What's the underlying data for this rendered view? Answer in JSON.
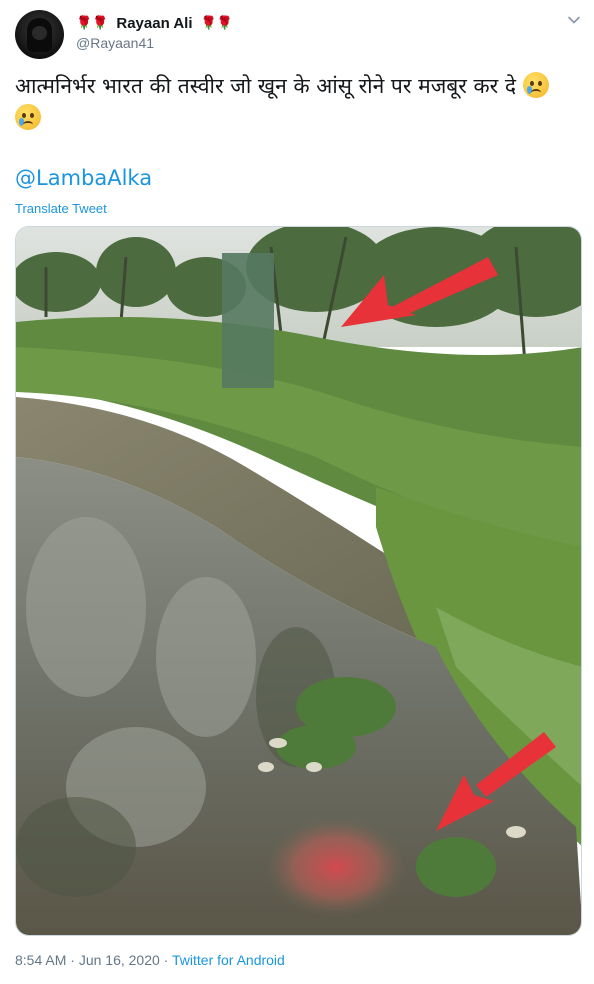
{
  "author": {
    "name": "Rayaan Ali",
    "handle": "@Rayaan41",
    "decor_left": "🌹🌹",
    "decor_right": "🌹🌹"
  },
  "tweet": {
    "text": "आत्मनिर्भर भारत की तस्वीर जो खून के आंसू रोने पर मजबूर कर दे",
    "mention": "@LambaAlka",
    "translate_label": "Translate Tweet"
  },
  "meta": {
    "time": "8:54 AM",
    "separator1": " · ",
    "date": "Jun 16, 2020",
    "separator2": " · ",
    "source": "Twitter for Android"
  },
  "icons": {
    "avatar": "hooded-figure-avatar",
    "caret": "chevron-down-icon",
    "emoji": "crying-face-emoji"
  },
  "colors": {
    "link": "#1b95e0",
    "secondary_text": "#657786",
    "arrow": "#e8323a"
  }
}
